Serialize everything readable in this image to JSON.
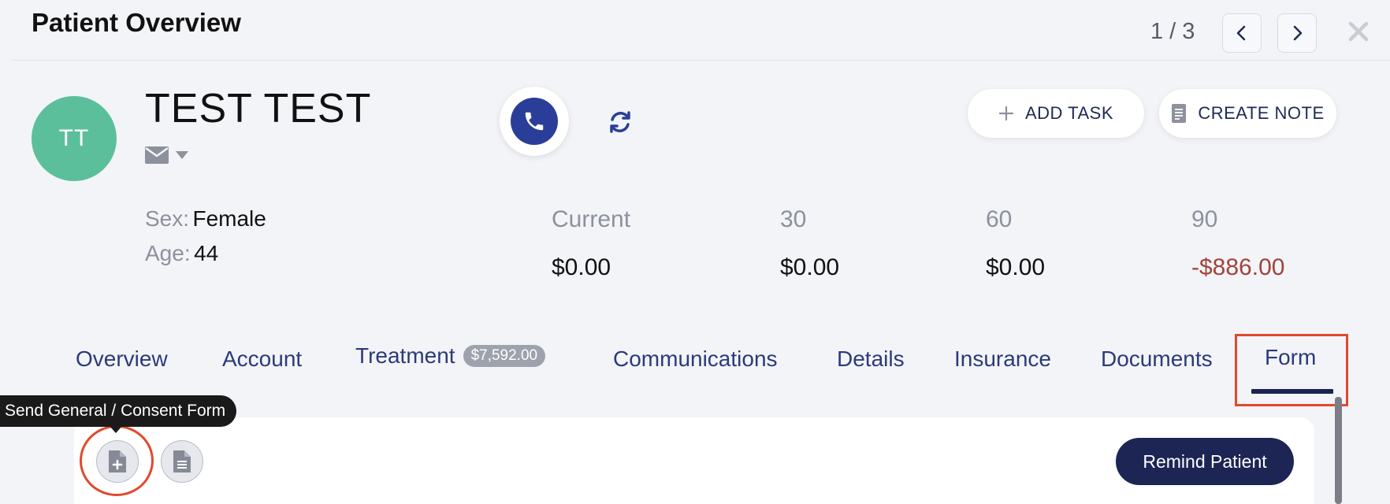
{
  "header": {
    "title": "Patient Overview",
    "pager": "1 / 3",
    "prev_icon": "chevron-left-icon",
    "next_icon": "chevron-right-icon",
    "close_icon": "close-icon"
  },
  "patient": {
    "initials": "TT",
    "name": "TEST TEST",
    "sex_label": "Sex:",
    "sex": "Female",
    "age_label": "Age:",
    "age": "44"
  },
  "actions": {
    "call_icon": "phone-icon",
    "refresh_icon": "refresh-icon",
    "add_task": "ADD TASK",
    "create_note": "CREATE NOTE"
  },
  "balances": [
    {
      "label": "Current",
      "value": "$0.00"
    },
    {
      "label": "30",
      "value": "$0.00"
    },
    {
      "label": "60",
      "value": "$0.00"
    },
    {
      "label": "90",
      "value": "-$886.00"
    }
  ],
  "tabs": [
    {
      "label": "Overview"
    },
    {
      "label": "Account"
    },
    {
      "label": "Treatment",
      "badge": "$7,592.00"
    },
    {
      "label": "Communications"
    },
    {
      "label": "Details"
    },
    {
      "label": "Insurance"
    },
    {
      "label": "Documents"
    },
    {
      "label": "Form",
      "active": true
    }
  ],
  "form_panel": {
    "tooltip": "Send General / Consent Form",
    "remind_button": "Remind Patient"
  },
  "colors": {
    "accent": "#1d2554",
    "avatar": "#5cbf9b",
    "call": "#2a3e99",
    "negative": "#a3423c",
    "highlight": "#e04a2c"
  }
}
